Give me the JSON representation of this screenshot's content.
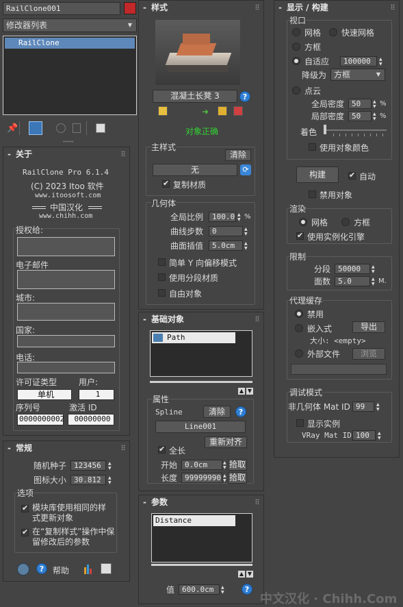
{
  "top": {
    "object_name": "RailClone001",
    "modifier_list": "修改器列表",
    "stack_item": "RailClone"
  },
  "about": {
    "header": "关于",
    "product": "RailClone Pro 6.1.4",
    "copyright": "(C) 2023 Itoo 软件",
    "site": "www.itoosoft.com",
    "localized": "中国汉化",
    "local_site": "www.chihh.com",
    "license_to": "授权给:",
    "email": "电子邮件",
    "city": "城市:",
    "country": "国家:",
    "phone": "电话:",
    "license_type_label": "许可证类型",
    "license_type_value": "单机",
    "users_label": "用户:",
    "users_value": "1",
    "serial_label": "序列号",
    "serial_value": "0000000002",
    "activation_label": "激活 ID",
    "activation_value": "00000000"
  },
  "general": {
    "header": "常规",
    "seed_label": "随机种子",
    "seed_value": "123456",
    "icon_size_label": "图标大小",
    "icon_size_value": "30.812",
    "options_label": "选项",
    "opt1": "模块库使用相同的样式更新对象",
    "opt2": "在“复制样式”操作中保留修改后的参数",
    "help_label": "帮助"
  },
  "style": {
    "header": "样式",
    "style_name": "混凝土长凳 3",
    "status": "对象正确",
    "main_style_label": "主样式",
    "clear": "清除",
    "none": "无",
    "copy_material": "复制材质",
    "geometry_label": "几何体",
    "global_scale_label": "全局比例",
    "global_scale_value": "100.0",
    "global_scale_unit": "%",
    "curve_steps_label": "曲线步数",
    "curve_steps_value": "0",
    "surface_interp_label": "曲面插值",
    "surface_interp_value": "5.0cm",
    "simple_y": "简单 Y 向偏移模式",
    "use_segment_mat": "使用分段材质",
    "free_object": "自由对象"
  },
  "base_objects": {
    "header": "基础对象",
    "item": "Path",
    "props_label": "属性",
    "spline_label": "Spline",
    "clear": "清除",
    "line_value": "Line001",
    "realign": "重新对齐",
    "full_length": "全长",
    "start_label": "开始",
    "start_value": "0.0cm",
    "pick": "拾取",
    "length_label": "长度",
    "length_value": "99999990",
    "pick2": "拾取"
  },
  "params": {
    "header": "参数",
    "item": "Distance",
    "value_label": "值",
    "value_value": "600.0cm"
  },
  "display": {
    "header": "显示 / 构建",
    "viewport_label": "视口",
    "mesh": "网格",
    "fast_mesh": "快速网格",
    "box": "方框",
    "adaptive": "自适应",
    "adaptive_value": "100000",
    "degrade_label": "降级为",
    "degrade_value": "方框",
    "point_cloud": "点云",
    "global_density_label": "全局密度",
    "global_density_value": "50",
    "local_density_label": "局部密度",
    "local_density_value": "50",
    "pct": "%",
    "color_label": "着色",
    "use_obj_color": "使用对象颜色",
    "build": "构建",
    "auto": "自动",
    "disable_obj": "禁用对象",
    "render_label": "渲染",
    "r_mesh": "网格",
    "r_box": "方框",
    "instancing": "使用实例化引擎",
    "limits_label": "限制",
    "segments_label": "分段",
    "segments_value": "50000",
    "faces_label": "面数",
    "faces_value": "5.0",
    "faces_unit": "M.",
    "proxy_label": "代理缓存",
    "disable": "禁用",
    "embedded": "嵌入式",
    "export": "导出",
    "size_label": "大小: <empty>",
    "external": "外部文件",
    "browse": "浏览",
    "debug_label": "调试模式",
    "non_geom_label": "非几何体 Mat ID",
    "non_geom_value": "99",
    "show_instances": "显示实例",
    "vray_label": "VRay Mat ID",
    "vray_value": "100"
  },
  "watermark": "中文汉化 · Chihh.Com"
}
